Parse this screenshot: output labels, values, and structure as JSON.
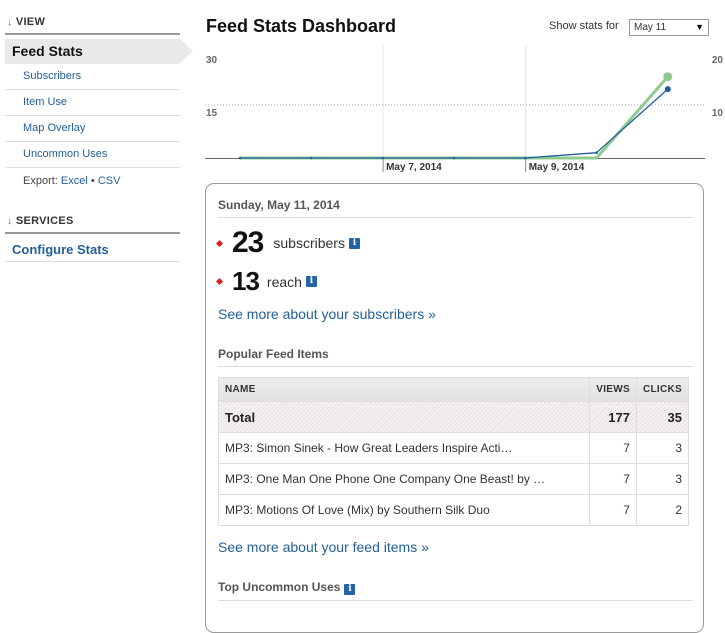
{
  "sidebar": {
    "view_heading": "VIEW",
    "heading_arrow": "↓",
    "active_item": "Feed Stats",
    "items": [
      {
        "label": "Subscribers"
      },
      {
        "label": "Item Use"
      },
      {
        "label": "Map Overlay"
      },
      {
        "label": "Uncommon Uses"
      }
    ],
    "export_label": "Export:",
    "export_excel": "Excel",
    "export_sep": "•",
    "export_csv": "CSV",
    "services_heading": "SERVICES",
    "configure": "Configure Stats"
  },
  "header": {
    "title": "Feed Stats Dashboard",
    "show_stats_label": "Show stats for",
    "selected_date": "May 11",
    "caret": "▼"
  },
  "chart_data": {
    "type": "line",
    "title": "",
    "x": [
      "May 5, 2014",
      "May 6, 2014",
      "May 7, 2014",
      "May 8, 2014",
      "May 9, 2014",
      "May 10, 2014",
      "May 11, 2014"
    ],
    "x_tick_labels": [
      "May 7, 2014",
      "May 9, 2014"
    ],
    "series": [
      {
        "name": "subscribers",
        "axis": "left",
        "color": "#8fcb8f",
        "values": [
          0,
          0,
          0,
          0,
          0,
          0,
          23
        ]
      },
      {
        "name": "reach",
        "axis": "right",
        "color": "#1f5fa0",
        "values": [
          0,
          0,
          0,
          0,
          0,
          1,
          13
        ]
      }
    ],
    "left_axis": {
      "ylim": [
        0,
        30
      ],
      "ticks": [
        "30",
        "15"
      ]
    },
    "right_axis": {
      "ylim": [
        0,
        20
      ],
      "ticks": [
        "20",
        "10"
      ]
    },
    "grid": true,
    "legend": "none"
  },
  "summary": {
    "date": "Sunday, May 11, 2014",
    "subscribers_value": "23",
    "subscribers_label": "subscribers",
    "reach_value": "13",
    "reach_label": "reach",
    "info_glyph": "i",
    "see_more_subscribers": "See more about your subscribers »"
  },
  "popular": {
    "title": "Popular Feed Items",
    "columns": [
      "NAME",
      "VIEWS",
      "CLICKS"
    ],
    "total": {
      "name": "Total",
      "views": "177",
      "clicks": "35"
    },
    "rows": [
      {
        "name": "MP3: Simon Sinek - How Great Leaders Inspire Acti…",
        "views": "7",
        "clicks": "3"
      },
      {
        "name": "MP3: One Man One Phone One Company One Beast! by …",
        "views": "7",
        "clicks": "3"
      },
      {
        "name": "MP3: Motions Of Love (Mix) by Southern Silk Duo",
        "views": "7",
        "clicks": "2"
      }
    ],
    "see_more": "See more about your feed items »"
  },
  "uncommon": {
    "title": "Top Uncommon Uses"
  }
}
